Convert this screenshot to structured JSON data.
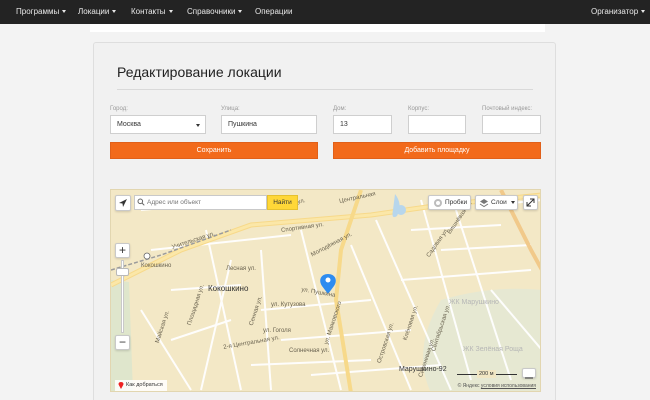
{
  "navbar": {
    "items": [
      {
        "label": "Программы"
      },
      {
        "label": "Локации"
      },
      {
        "label": "Контакты"
      },
      {
        "label": "Справочники"
      },
      {
        "label": "Операции"
      }
    ],
    "user_menu": {
      "label": "Организатор"
    }
  },
  "page": {
    "title": "Редактирование локации"
  },
  "form": {
    "city": {
      "label": "Город:",
      "value": "Москва"
    },
    "street": {
      "label": "Улица:",
      "value": "Пушкина"
    },
    "house": {
      "label": "Дом:",
      "value": "13"
    },
    "building": {
      "label": "Корпус:",
      "value": ""
    },
    "postcode": {
      "label": "Почтовый индекс:",
      "value": ""
    },
    "save_label": "Сохранить",
    "add_area_label": "Добавить площадку"
  },
  "map": {
    "search": {
      "placeholder": "Адрес или объект",
      "button_label": "Найти"
    },
    "traffic_label": "Пробки",
    "layers_label": "Слои",
    "route_label": "Как добраться",
    "scale_label": "200 м",
    "copyright_prefix": "© Яндекс",
    "terms_label": "условия использования",
    "labels": {
      "kokoshkino": "Кокошкино",
      "kokoshkino_station": "Кокошкино",
      "uchitelskaya": "Учительская ул.",
      "uchitelskaya_2": "Учительская ул.",
      "sportivnaya": "Спортивная ул.",
      "tsentralnaya": "Центральная",
      "molodezhnaya": "Молодёжная ул.",
      "pushkina": "ул. Пушкина",
      "lesnaya": "Лесная ул.",
      "gogolya": "ул. Гоголя",
      "kutuzova": "ул. Кутузова",
      "solnechnaya": "Солнечная ул.",
      "mayakovskogo": "ул. Маяковского",
      "sadovaya": "Садовая ул.",
      "vishnevaya": "Вишнёвая ул.",
      "kleonovaya": "Клёновая ул.",
      "sirenevaya": "Сиреневая ул.",
      "sentyabrskaya": "Сентябрьская ул.",
      "ostrovskogo": "Островская ул.",
      "marushkino92": "Марушкино-92",
      "zhk_marushkino": "ЖК Марушкино",
      "zhk_zelenaya": "ЖК Зелёная Роща",
      "mayskaya": "Майская ул.",
      "tsentralnaya_2": "2-я Центральная ул.",
      "sennaya": "Сенная ул.",
      "ploschadnaya": "Площадная ул."
    }
  },
  "colors": {
    "accent": "#f26a1b",
    "search_button": "#ffd738",
    "navbar": "#232323",
    "pin": "#2d8cf0"
  }
}
